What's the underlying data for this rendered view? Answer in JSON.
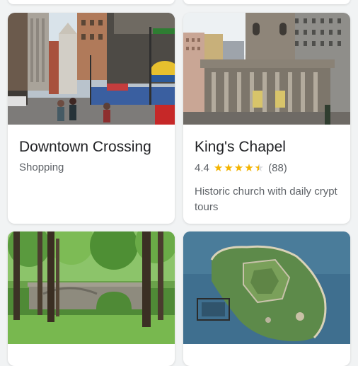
{
  "cards": [
    {
      "title": "Downtown Crossing",
      "category": "Shopping"
    },
    {
      "title": "King's Chapel",
      "rating": "4.4",
      "rating_value": 4.4,
      "review_count": "(88)",
      "description": "Historic church with daily crypt tours"
    },
    {
      "image": "park-stone-bridge-photo"
    },
    {
      "image": "island-aerial-photo"
    }
  ],
  "colors": {
    "background": "#f1f3f4",
    "star": "#f4b400",
    "title": "#202124",
    "secondary": "#5f6368"
  }
}
